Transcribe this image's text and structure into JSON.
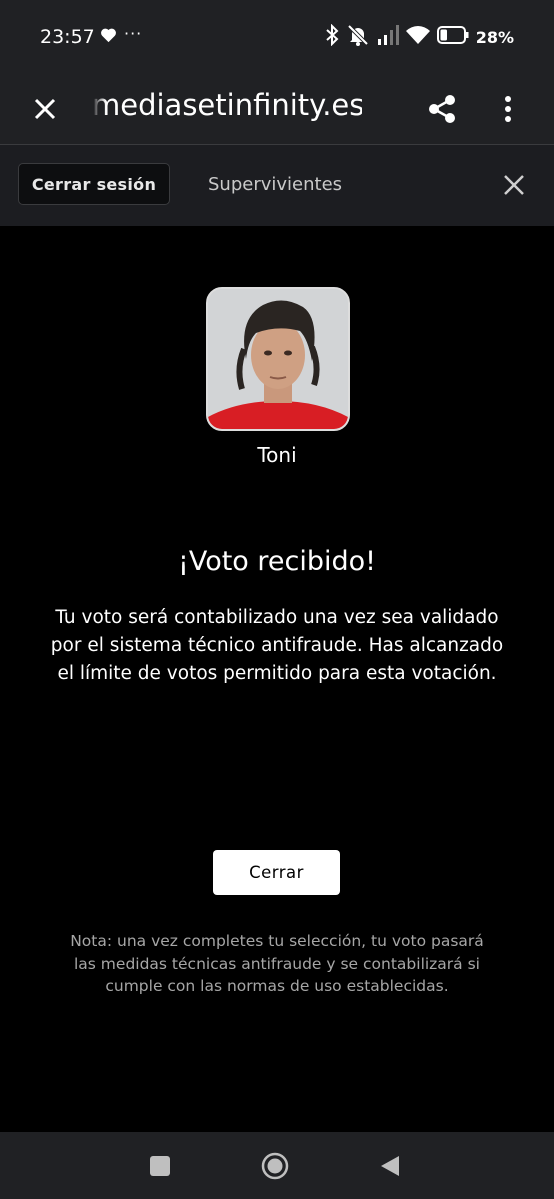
{
  "status_bar": {
    "time": "23:57",
    "more_dots": "···",
    "battery_percent": "28%",
    "battery_level": 0.28
  },
  "browser": {
    "url": "mediasetinfinity.es"
  },
  "subheader": {
    "logout_label": "Cerrar sesión",
    "title": "Supervivientes"
  },
  "vote": {
    "candidate_name": "Toni",
    "heading": "¡Voto recibido!",
    "message": "Tu voto será contabilizado una vez sea validado por el sistema técnico antifraude. Has alcanzado el límite de votos permitido para esta votación.",
    "close_label": "Cerrar",
    "note": "Nota: una vez completes tu selección, tu voto pasará las medidas técnicas antifraude y se contabilizará si cumple con las normas de uso establecidas."
  }
}
